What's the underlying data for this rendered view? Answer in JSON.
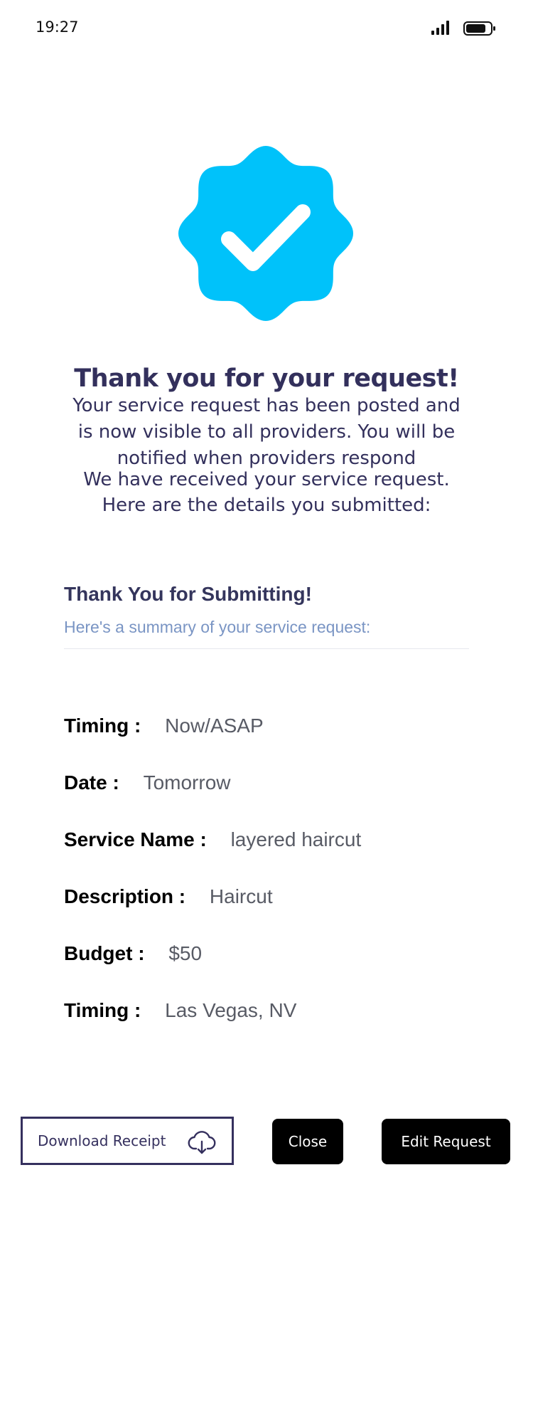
{
  "status_bar": {
    "time": "19:27",
    "icons": [
      "signal-icon",
      "battery-icon"
    ]
  },
  "badge": {
    "icon": "verified-check-icon",
    "color": "#00C2FA"
  },
  "confirmation": {
    "headline": "Thank you for your request!",
    "intro": "Your service request has been posted and is now visible to all providers. You will be notified when providers respond",
    "details_intro": "We have received your service request. Here are the details you submitted:"
  },
  "summary": {
    "title": "Thank You for Submitting!",
    "subtitle": "Here's a summary of your service request:"
  },
  "details": [
    {
      "label": "Timing :",
      "value": "Now/ASAP"
    },
    {
      "label": "Date :",
      "value": "Tomorrow"
    },
    {
      "label": "Service Name :",
      "value": "layered haircut"
    },
    {
      "label": "Description :",
      "value": "Haircut"
    },
    {
      "label": "Budget :",
      "value": "$50"
    },
    {
      "label": "Timing :",
      "value": "Las Vegas, NV"
    }
  ],
  "actions": {
    "download_label": "Download Receipt",
    "download_icon": "cloud-download-icon",
    "close_label": "Close",
    "edit_label": "Edit Request"
  },
  "colors": {
    "heading": "#33305C",
    "subtitle": "#7A95C4",
    "button_dark": "#000000",
    "download_border": "#35305E"
  }
}
